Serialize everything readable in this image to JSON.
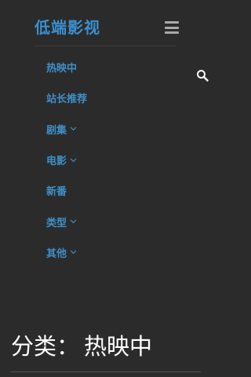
{
  "header": {
    "logo_text": "低端影视",
    "menu_icon": "hamburger-menu-icon",
    "search_icon": "search-icon"
  },
  "nav": {
    "items": [
      {
        "label": "热映中",
        "has_dropdown": false
      },
      {
        "label": "站长推荐",
        "has_dropdown": false
      },
      {
        "label": "剧集",
        "has_dropdown": true
      },
      {
        "label": "电影",
        "has_dropdown": true
      },
      {
        "label": "新番",
        "has_dropdown": false
      },
      {
        "label": "类型",
        "has_dropdown": true
      },
      {
        "label": "其他",
        "has_dropdown": true
      }
    ]
  },
  "category": {
    "prefix": "分类：",
    "name": "热映中"
  },
  "colors": {
    "background": "#2b2b2b",
    "accent": "#3a8fd0",
    "text": "#ffffff"
  }
}
